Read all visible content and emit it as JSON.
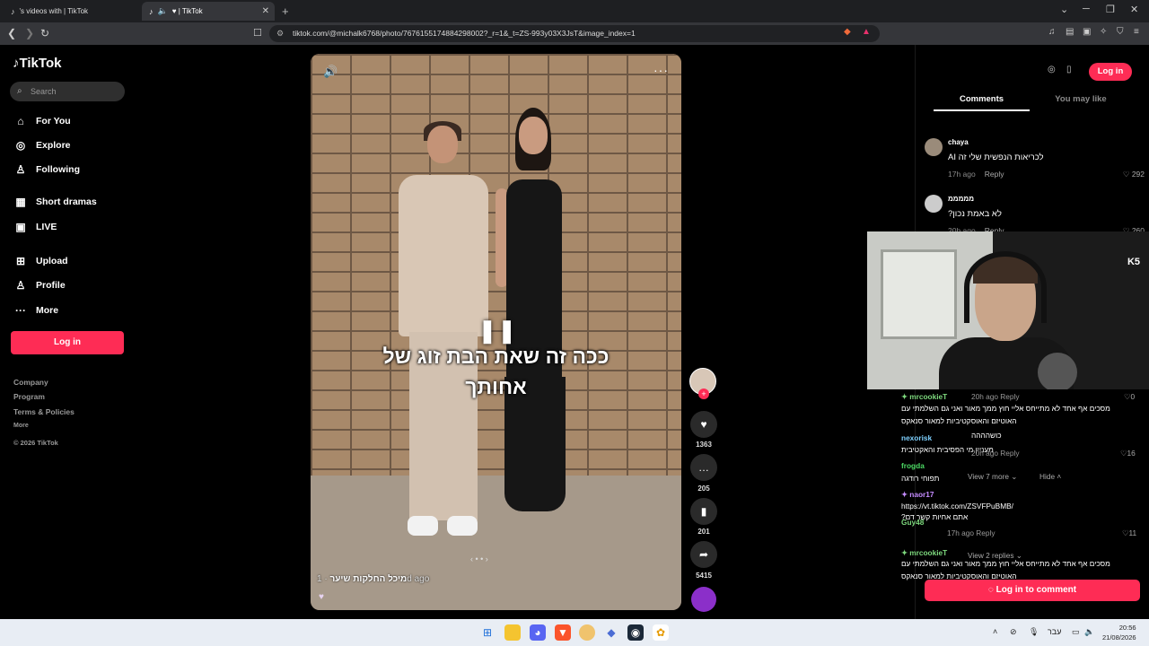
{
  "browser": {
    "tabs": [
      {
        "label": "'s videos with | TikTok"
      },
      {
        "label": "♥ | TikTok"
      }
    ],
    "url": "tiktok.com/@michalk6768/photo/7676155174884298002?_r=1&_t=ZS-993y03X3JsT&image_index=1"
  },
  "sidebar": {
    "logo": "TikTok",
    "search_placeholder": "Search",
    "nav": [
      {
        "label": "For You",
        "icon": "home-icon"
      },
      {
        "label": "Explore",
        "icon": "compass-icon"
      },
      {
        "label": "Following",
        "icon": "person-icon"
      },
      {
        "label": "Short dramas",
        "icon": "film-icon"
      },
      {
        "label": "LIVE",
        "icon": "live-icon"
      },
      {
        "label": "Upload",
        "icon": "plus-square-icon"
      },
      {
        "label": "Profile",
        "icon": "profile-icon"
      },
      {
        "label": "More",
        "icon": "dots-icon"
      }
    ],
    "login_label": "Log in",
    "footer": [
      "Company",
      "Program",
      "Terms & Policies",
      "More"
    ],
    "copyright": "© 2026 TikTok"
  },
  "video": {
    "overlay_line1": "ככה זה שאת הבת זוג של",
    "overlay_line2": "אחותך",
    "author": "מיכל החלקות שיער",
    "time": "· 1d ago",
    "pager": "‹ • • ›"
  },
  "actions": {
    "likes": "1363",
    "comments": "205",
    "saves": "201",
    "shares": "5415"
  },
  "rightpanel": {
    "login_label": "Log in",
    "tabs": [
      "Comments",
      "You may like"
    ],
    "comments": [
      {
        "user": "chaya",
        "text": "לכריאות הנפשית שלי זה AI",
        "time": "17h ago",
        "reply": "Reply",
        "likes": "292"
      },
      {
        "user": "מממממ",
        "text": "לא באמת נכון?",
        "time": "20h ago",
        "reply": "Reply",
        "likes": "260"
      }
    ],
    "login_comment": "Log in to comment"
  },
  "stream_chat": [
    {
      "user": "mrcookieT",
      "meta": "20h ago  Reply",
      "likes": "0"
    },
    {
      "text": "מסכים אף אחד לא מתייחס אליי חוץ ממך מאור ואני גם השלמתי עם"
    },
    {
      "text": "האוטיזם והאוסקטיביות למאור סנאקס"
    },
    {
      "text": "כושהההה"
    },
    {
      "user": "nexorisk",
      "meta": "20h ago  Reply",
      "likes": "16"
    },
    {
      "text": "מעניין מי הפסיבית והאקטיבית"
    },
    {
      "user": "frogda",
      "more": "View 7 more ⌄",
      "hide": "Hide ˄"
    },
    {
      "text": "תפוחי רודגה"
    },
    {
      "user": "naor17"
    },
    {
      "text": "https://vt.tiktok.com/ZSVFPuBMB/"
    },
    {
      "text": "אתם אחיות קשר דם?"
    },
    {
      "user": "Guy48",
      "meta": "17h ago  Reply",
      "likes": "11"
    },
    {
      "user": "mrcookieT",
      "more": "View 2 replies ⌄"
    },
    {
      "text": "מסכים אף אחד לא מתייחס אליי חוץ ממך מאור ואני גם השלמתי עם"
    },
    {
      "text": "האוטיזם והאוסקטיביות למאור סנאקס"
    }
  ],
  "webcam": {
    "logo": "K5"
  },
  "taskbar": {
    "lang": "עבר",
    "time": "20:56",
    "date": "21/08/2026"
  }
}
